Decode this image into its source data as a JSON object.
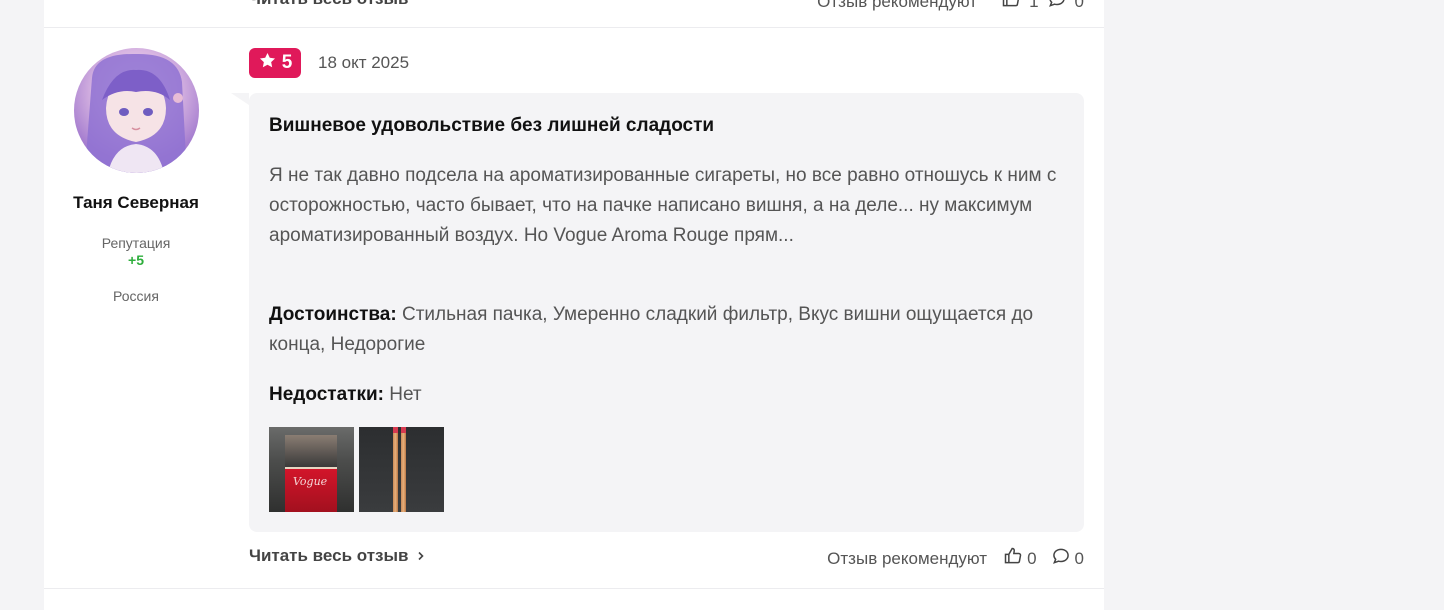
{
  "previous_review": {
    "read_more_label": "Читать весь отзыв",
    "recommend_label": "Отзыв рекомендуют",
    "likes": "1",
    "comments": "0"
  },
  "author": {
    "name": "Таня Северная",
    "reputation_label": "Репутация",
    "reputation_value": "+5",
    "country": "Россия"
  },
  "review": {
    "rating": "5",
    "date": "18 окт 2025",
    "title": "Вишневое удовольствие без лишней сладости",
    "text": "Я не так давно подсела на ароматизированные сигареты, но все равно отношусь к ним с осторожностью, часто бывает, что на пачке написано вишня, а на деле... ну максимум ароматизированный воздух. Но Vogue Aroma Rouge прям...",
    "pros_label": "Достоинства:",
    "pros": "Стильная пачка, Умеренно сладкий фильтр, Вкус вишни ощущается до конца, Недорогие",
    "cons_label": "Недостатки:",
    "cons": "Нет",
    "photo_1_logo": "Vogue"
  },
  "footer": {
    "read_more_label": "Читать весь отзыв",
    "recommend_label": "Отзыв рекомендуют",
    "likes": "0",
    "comments": "0"
  },
  "colors": {
    "rating_badge": "#e0195a",
    "reputation_positive": "#2eae3c",
    "bubble_bg": "#f4f4f6"
  }
}
